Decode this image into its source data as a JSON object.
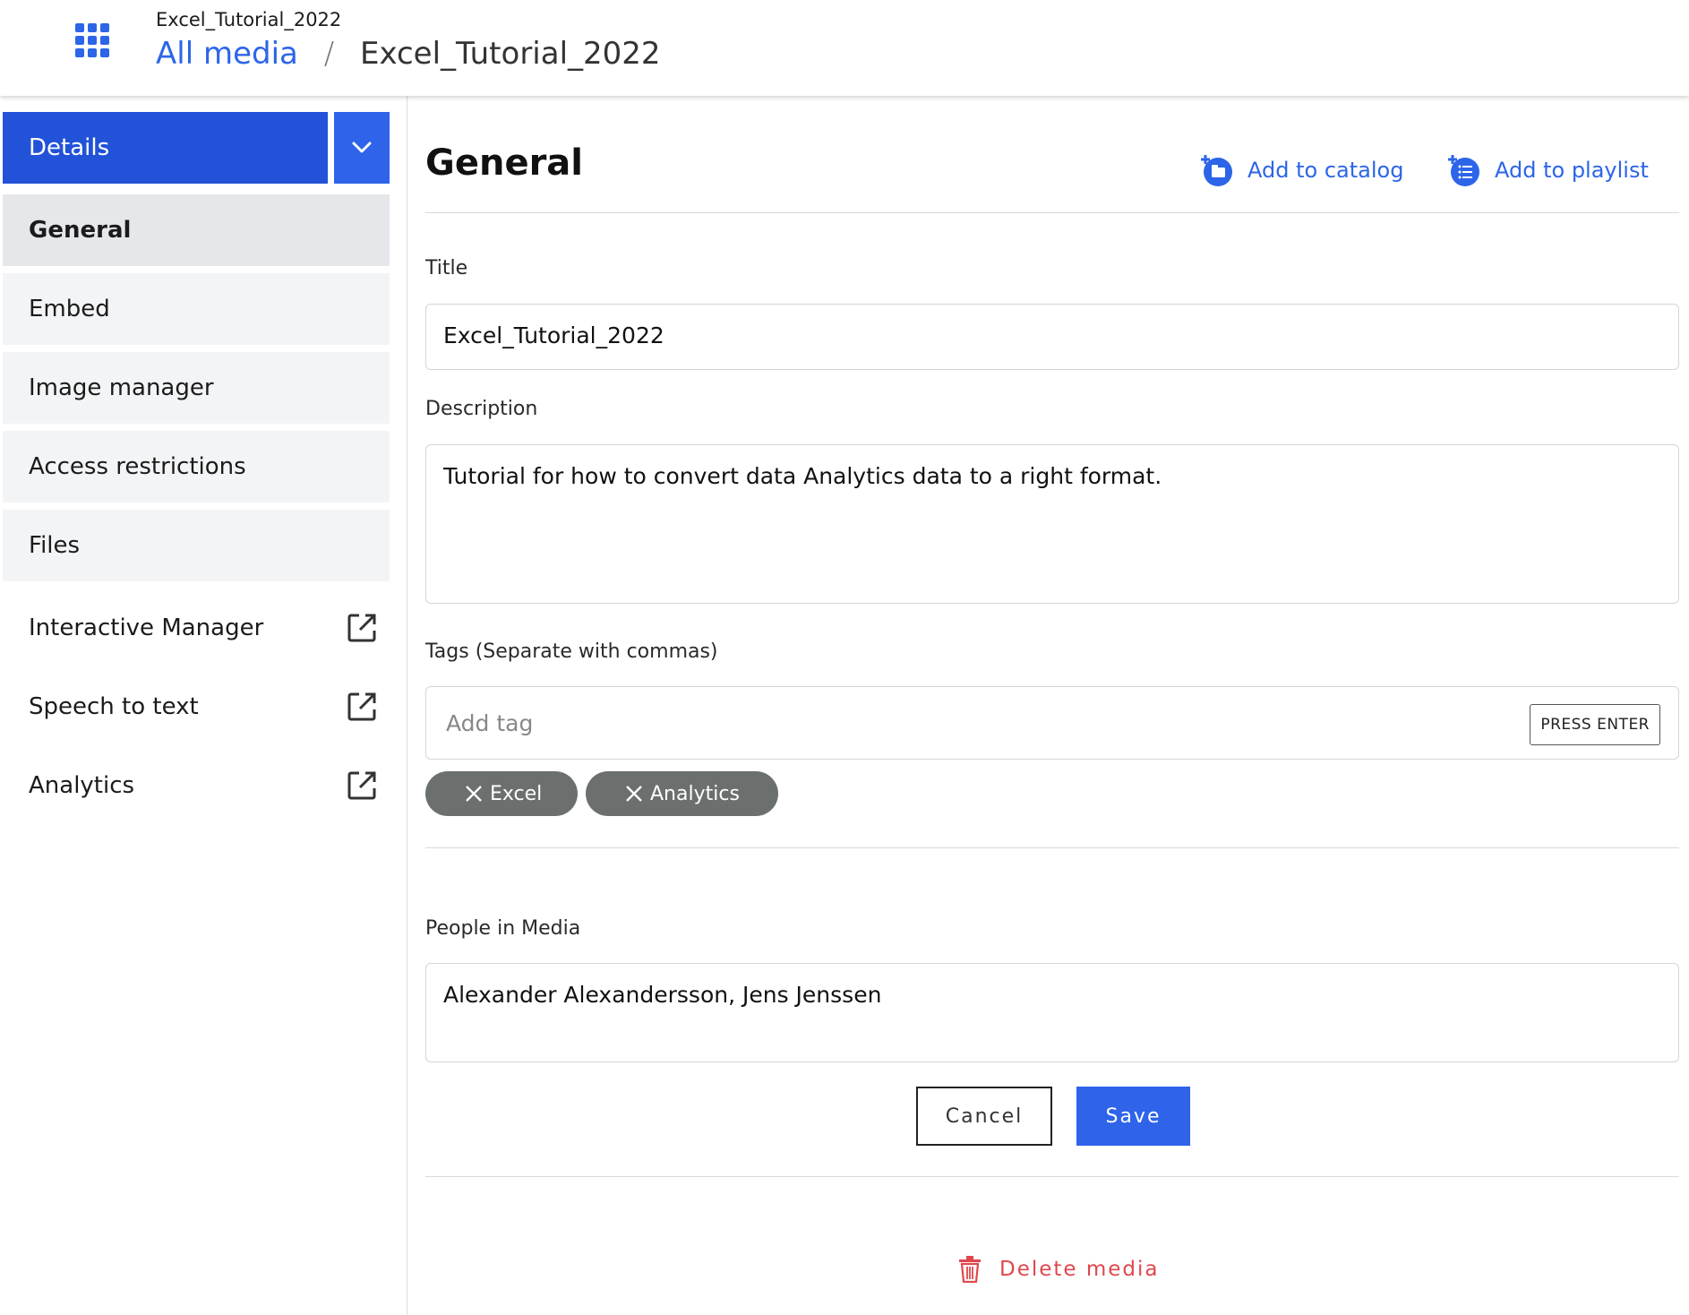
{
  "header": {
    "subtitle": "Excel_Tutorial_2022",
    "breadcrumb_link": "All media",
    "breadcrumb_sep": "/",
    "breadcrumb_current": "Excel_Tutorial_2022",
    "apps_icon": "apps-grid-icon",
    "accent_color": "#2c65e8"
  },
  "sidebar": {
    "details_label": "Details",
    "toggle_icon": "chevron-down-icon",
    "items": [
      {
        "label": "General"
      },
      {
        "label": "Embed"
      },
      {
        "label": "Image manager"
      },
      {
        "label": "Access restrictions"
      },
      {
        "label": "Files"
      }
    ],
    "external_links": [
      {
        "label": "Interactive Manager",
        "icon": "external-link-icon"
      },
      {
        "label": "Speech to text",
        "icon": "external-link-icon"
      },
      {
        "label": "Analytics",
        "icon": "external-link-icon"
      }
    ]
  },
  "main": {
    "section_title": "General",
    "add_to_catalog": "Add to catalog",
    "add_to_playlist": "Add to playlist",
    "title_label": "Title",
    "title_value": "Excel_Tutorial_2022",
    "description_label": "Description",
    "description_value": "Tutorial for how to convert data Analytics data to a right format.",
    "tags_label": "Tags (Separate with commas)",
    "tags_placeholder": "Add tag",
    "press_enter": "PRESS ENTER",
    "tags": [
      "Excel",
      "Analytics"
    ],
    "people_label": "People in Media",
    "people_value": "Alexander Alexandersson, Jens Jenssen",
    "cancel_label": "Cancel",
    "save_label": "Save",
    "delete_label": "Delete media",
    "delete_color": "#e0474c"
  }
}
